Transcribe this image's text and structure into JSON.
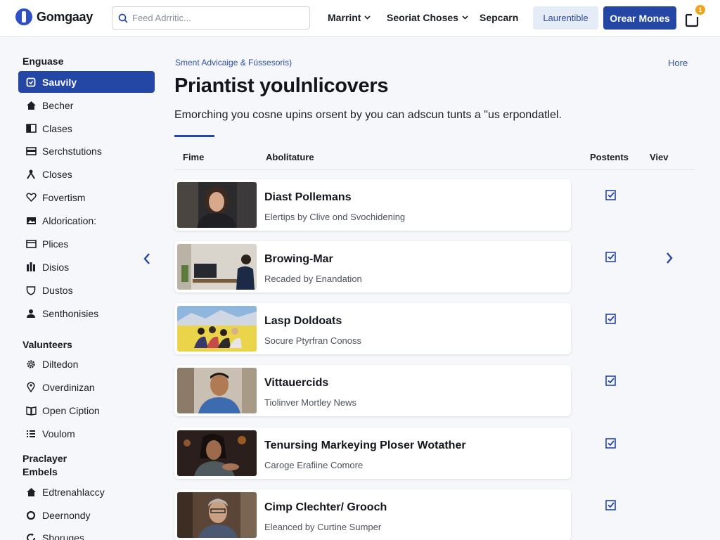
{
  "header": {
    "logo_text": "Gomgaay",
    "search_placeholder": "Feed Adrritic...",
    "nav": [
      {
        "label": "Marrint"
      },
      {
        "label": "Seoriat Choses"
      },
      {
        "label": "Sepcarn"
      }
    ],
    "secondary_button": "Laurentible",
    "primary_button": "Orear Mones",
    "notification_badge": "1"
  },
  "sidebar": {
    "sections": [
      {
        "title": "Enguase",
        "items": [
          {
            "label": "Sauvily",
            "icon": "widget-icon",
            "active": true
          },
          {
            "label": "Becher",
            "icon": "home-icon"
          },
          {
            "label": "Clases",
            "icon": "book-icon"
          },
          {
            "label": "Serchstutions",
            "icon": "card-icon"
          },
          {
            "label": "Closes",
            "icon": "person-icon"
          },
          {
            "label": "Fovertism",
            "icon": "heart-icon"
          },
          {
            "label": "Aldorication:",
            "icon": "image-icon"
          },
          {
            "label": "Plices",
            "icon": "calendar-icon"
          },
          {
            "label": "Disios",
            "icon": "bars-icon"
          },
          {
            "label": "Dustos",
            "icon": "shield-icon"
          },
          {
            "label": "Senthonisies",
            "icon": "user-icon"
          }
        ]
      },
      {
        "title": "Valunteers",
        "items": [
          {
            "label": "Diltedon",
            "icon": "gear-icon"
          },
          {
            "label": "Overdinizan",
            "icon": "pin-icon"
          },
          {
            "label": "Open Ciption",
            "icon": "open-book-icon"
          },
          {
            "label": "Voulom",
            "icon": "list-icon"
          }
        ]
      },
      {
        "title": "Praclayer Embels",
        "items": [
          {
            "label": "Edtrenahlaccy",
            "icon": "home-icon"
          },
          {
            "label": "Deernondy",
            "icon": "circle-icon"
          },
          {
            "label": "Shoruges",
            "icon": "refresh-icon"
          }
        ]
      }
    ]
  },
  "main": {
    "breadcrumb": "Sment Advicaige & Fússesoris)",
    "more_link": "Hore",
    "title": "Priantist youlnlicovers",
    "description": "Emorching you cosne upins orsent by you can adscun tunts a \"us erpondatlel.",
    "columns": [
      "Fime",
      "Abolitature",
      "Postents",
      "Viev"
    ],
    "rows": [
      {
        "title": "Diast Pollemans",
        "subtitle": "Elertips by Clive ond Svochidening",
        "checked": true
      },
      {
        "title": "Browing-Mar",
        "subtitle": "Recaded by Enandation",
        "checked": true
      },
      {
        "title": "Lasp Doldoats",
        "subtitle": "Socure Ptyrfran Conoss",
        "checked": true
      },
      {
        "title": "Vittauercids",
        "subtitle": "Tiolinver Mortley News",
        "checked": true
      },
      {
        "title": "Tenursing Markeying Ploser Wotather",
        "subtitle": "Caroge Erafiine Comore",
        "checked": true
      },
      {
        "title": "Cimp Clechter/ Grooch",
        "subtitle": "Eleanced by Curtine Sumper",
        "checked": true
      }
    ]
  },
  "colors": {
    "accent": "#2447a6",
    "link": "#2f4fa8",
    "badge": "#f2a21b"
  }
}
